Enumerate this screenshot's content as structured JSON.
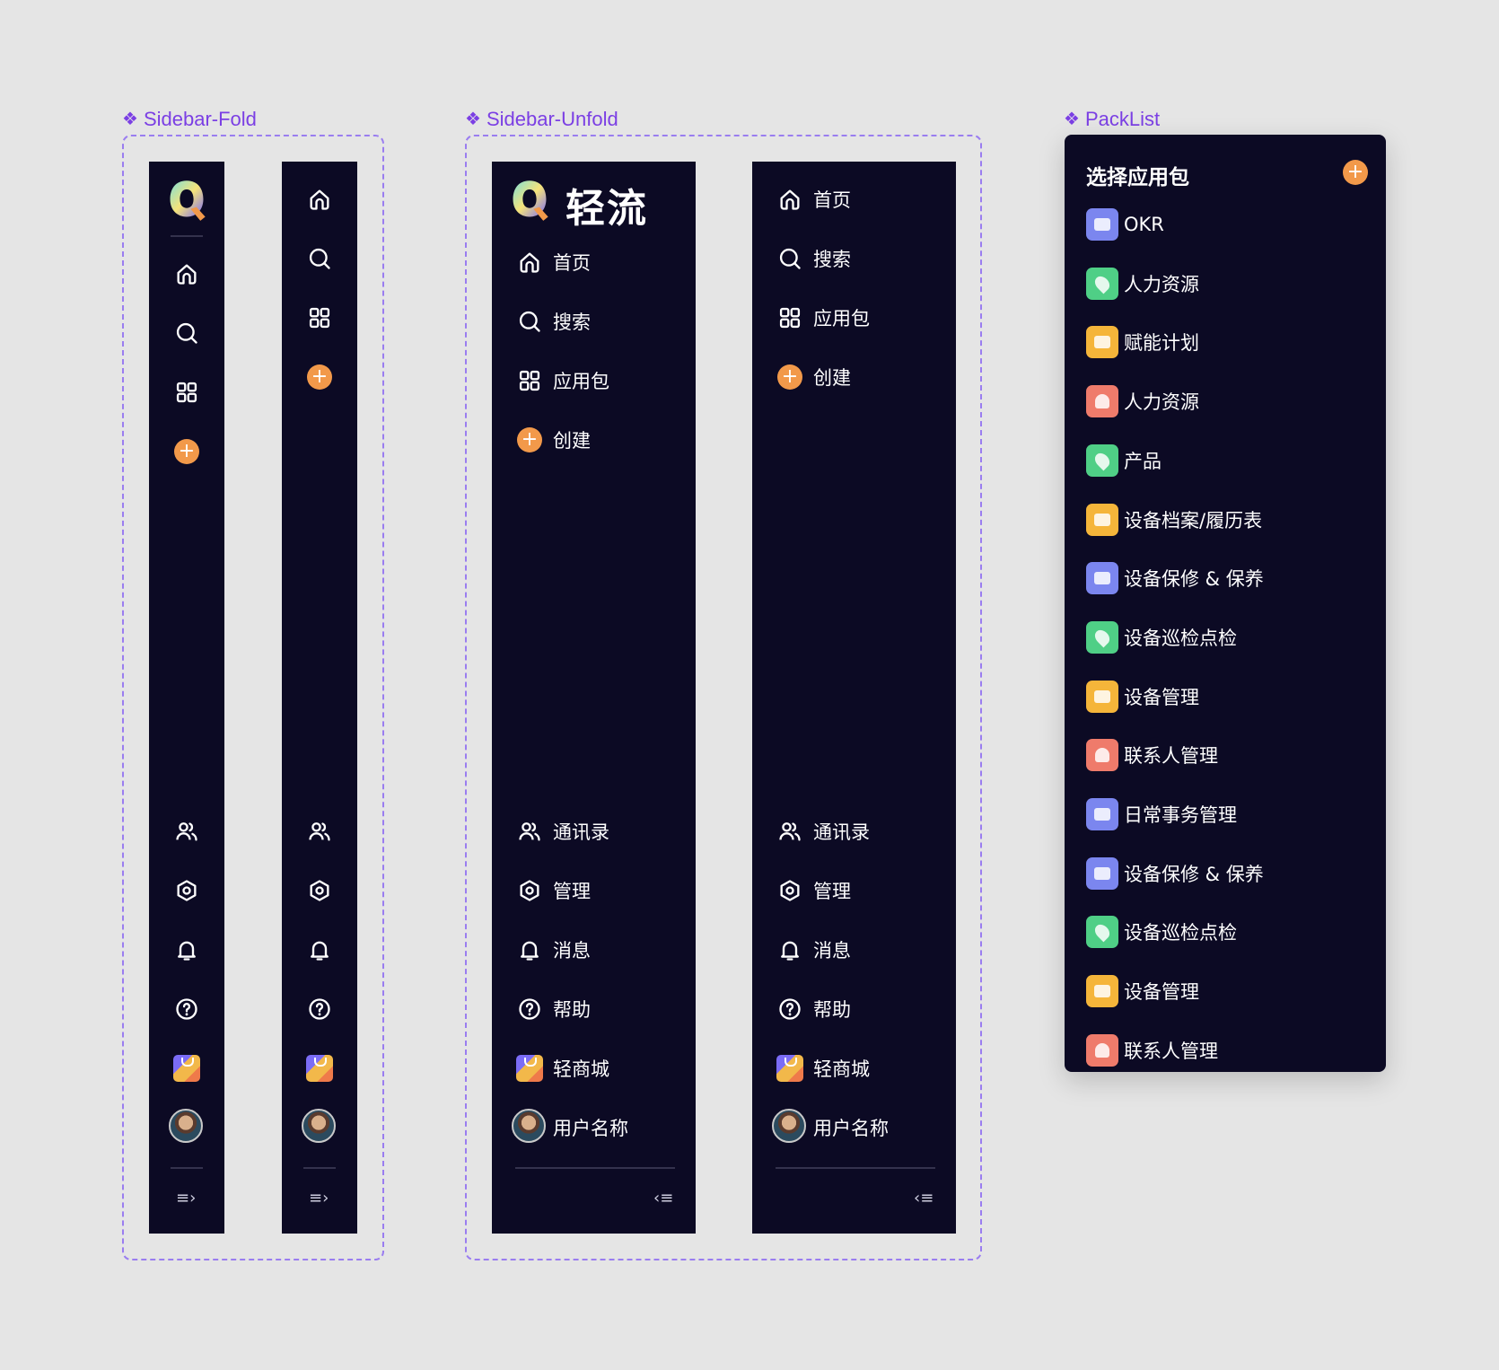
{
  "sections": {
    "fold": "Sidebar-Fold",
    "unfold": "Sidebar-Unfold",
    "packlist": "PackList"
  },
  "logo": {
    "text": "轻流"
  },
  "nav": {
    "home": "首页",
    "search": "搜索",
    "apps": "应用包",
    "create": "创建",
    "contacts": "通讯录",
    "manage": "管理",
    "messages": "消息",
    "help": "帮助",
    "mall": "轻商城",
    "user": "用户名称"
  },
  "packlist": {
    "title": "选择应用包",
    "items": [
      {
        "label": "OKR",
        "icon": "briefcase-icon",
        "color": "#7b86ef"
      },
      {
        "label": "人力资源",
        "icon": "map-pin-icon",
        "color": "#4fcf86"
      },
      {
        "label": "赋能计划",
        "icon": "car-icon",
        "color": "#f5b53a"
      },
      {
        "label": "人力资源",
        "icon": "user-icon",
        "color": "#ef7b6b"
      },
      {
        "label": "产品",
        "icon": "map-pin-icon",
        "color": "#4fcf86"
      },
      {
        "label": "设备档案/履历表",
        "icon": "car-icon",
        "color": "#f5b53a"
      },
      {
        "label": "设备保修 & 保养",
        "icon": "briefcase-icon",
        "color": "#7b86ef"
      },
      {
        "label": "设备巡检点检",
        "icon": "map-pin-icon",
        "color": "#4fcf86"
      },
      {
        "label": "设备管理",
        "icon": "car-icon",
        "color": "#f5b53a"
      },
      {
        "label": "联系人管理",
        "icon": "user-icon",
        "color": "#ef7b6b"
      },
      {
        "label": "日常事务管理",
        "icon": "briefcase-icon",
        "color": "#7b86ef"
      },
      {
        "label": "设备保修 & 保养",
        "icon": "briefcase-icon",
        "color": "#7b86ef"
      },
      {
        "label": "设备巡检点检",
        "icon": "map-pin-icon",
        "color": "#4fcf86"
      },
      {
        "label": "设备管理",
        "icon": "car-icon",
        "color": "#f5b53a"
      },
      {
        "label": "联系人管理",
        "icon": "user-icon",
        "color": "#ef7b6b"
      }
    ]
  },
  "colors": {
    "sidebar_bg": "#0c0a24",
    "accent": "#f2994a",
    "label": "#7b3fe4"
  }
}
